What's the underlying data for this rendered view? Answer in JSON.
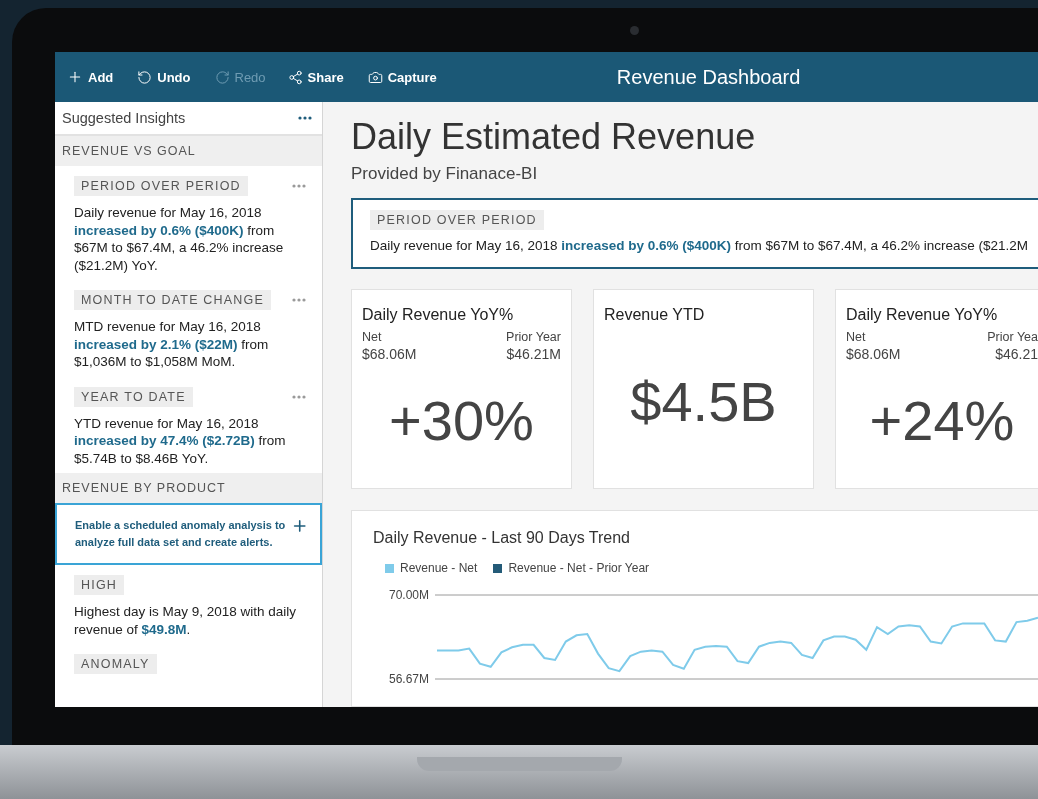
{
  "toolbar": {
    "actions": [
      {
        "kind": "add",
        "label": "Add",
        "disabled": false
      },
      {
        "kind": "undo",
        "label": "Undo",
        "disabled": false
      },
      {
        "kind": "redo",
        "label": "Redo",
        "disabled": true
      },
      {
        "kind": "share",
        "label": "Share",
        "disabled": false
      },
      {
        "kind": "capture",
        "label": "Capture",
        "disabled": false
      }
    ],
    "title": "Revenue Dashboard"
  },
  "sidebar": {
    "title": "Suggested Insights",
    "sections": [
      {
        "heading": "REVENUE VS GOAL",
        "items": [
          {
            "kind": "insight",
            "tag": "PERIOD OVER PERIOD",
            "menu": true,
            "text": "Daily revenue for May 16, 2018 **increased by 0.6% ($400K)** from $67M to $67.4M, a 46.2% increase ($21.2M) YoY."
          },
          {
            "kind": "insight",
            "tag": "MONTH TO DATE CHANGE",
            "menu": true,
            "text": "MTD revenue for May 16, 2018 **increased by 2.1% ($22M)** from $1,036M to $1,058M MoM."
          },
          {
            "kind": "insight",
            "tag": "YEAR TO DATE",
            "menu": true,
            "text": "YTD revenue for May 16, 2018 **increased by 47.4% ($2.72B)** from $5.74B to $8.46B YoY."
          }
        ]
      },
      {
        "heading": "REVENUE BY PRODUCT",
        "items": [
          {
            "kind": "prompt",
            "text": "**Enable a scheduled anomaly analysis to analyze full data set and create alerts.**"
          },
          {
            "kind": "insight",
            "tag": "HIGH",
            "menu": false,
            "text": "Highest day is May 9, 2018 with daily revenue of **$49.8M**."
          },
          {
            "kind": "insight",
            "tag": "ANOMALY",
            "menu": false
          }
        ]
      }
    ]
  },
  "main": {
    "title": "Daily Estimated Revenue",
    "subtitle": "Provided by Finanace-BI",
    "highlight": {
      "tag": "PERIOD OVER PERIOD",
      "text": "Daily revenue for May 16, 2018 **increased by 0.6% ($400K)** from $67M to $67.4M, a 46.2% increase ($21.2M"
    },
    "kpis": [
      {
        "kind": "comparison",
        "title": "Daily Revenue YoY%",
        "left_label": "Net",
        "left_value": "$68.06M",
        "right_label": "Prior Year",
        "right_value": "$46.21M",
        "value": "+30%"
      },
      {
        "kind": "single",
        "title": "Revenue YTD",
        "value": "$4.5B"
      },
      {
        "kind": "comparison",
        "title": "Daily Revenue YoY%",
        "left_label": "Net",
        "left_value": "$68.06M",
        "right_label": "Prior Yea",
        "right_value": "$46.21",
        "value": "+24%"
      }
    ],
    "chart": {
      "title": "Daily Revenue - Last 90 Days Trend",
      "chart_data": {
        "type": "line",
        "ylim": [
          56.67,
          70
        ],
        "yticks": [
          {
            "value": 70,
            "label": "70.00M"
          },
          {
            "value": 56.67,
            "label": "56.67M"
          }
        ],
        "series": [
          {
            "name": "Revenue - Net",
            "color": "#7fcbea",
            "values": [
              61.2,
              61.2,
              61.2,
              61.5,
              59.1,
              58.6,
              60.9,
              61.7,
              62.1,
              62.1,
              60.0,
              59.7,
              62.6,
              63.6,
              63.8,
              60.7,
              58.4,
              57.9,
              60.3,
              61.0,
              61.2,
              61.0,
              58.9,
              58.3,
              61.3,
              61.8,
              61.9,
              61.8,
              59.5,
              59.2,
              61.8,
              62.4,
              62.6,
              62.4,
              60.5,
              60.0,
              62.8,
              63.4,
              63.4,
              62.9,
              61.3,
              64.9,
              63.8,
              65.0,
              65.2,
              65.0,
              62.6,
              62.3,
              65.0,
              65.5,
              65.5,
              65.5,
              62.8,
              62.6,
              65.7,
              65.9,
              66.4
            ]
          },
          {
            "name": "Revenue - Net - Prior Year",
            "color": "#245b78",
            "values": [
              null,
              null,
              null,
              null,
              null,
              null,
              null,
              null,
              null,
              null,
              null,
              null,
              null,
              null,
              null,
              null,
              null,
              null,
              null,
              null,
              null,
              null,
              null,
              null,
              null,
              null,
              null,
              null,
              null,
              null,
              null,
              null,
              null,
              null,
              null,
              null,
              null,
              null,
              null,
              null,
              null,
              null,
              null,
              null,
              null,
              null,
              null,
              null,
              null,
              null,
              null,
              null,
              null,
              null,
              null,
              null,
              null
            ]
          }
        ]
      }
    }
  }
}
